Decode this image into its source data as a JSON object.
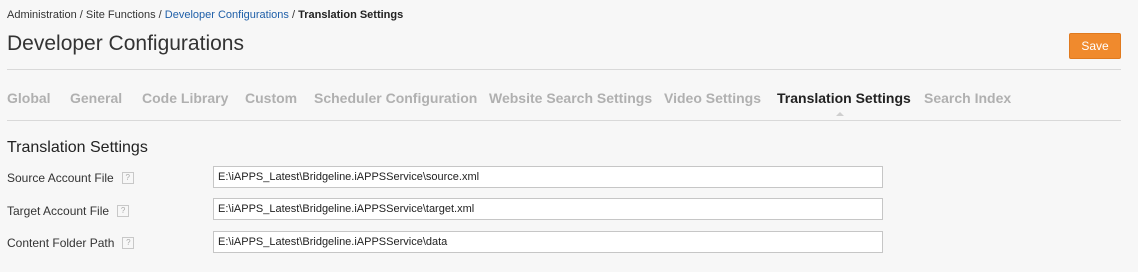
{
  "breadcrumb": {
    "items": [
      "Administration",
      "Site Functions",
      "Developer Configurations",
      "Translation Settings"
    ],
    "separator": "/"
  },
  "page": {
    "title": "Developer Configurations",
    "save_label": "Save"
  },
  "tabs": [
    {
      "label": "Global"
    },
    {
      "label": "General"
    },
    {
      "label": "Code Library"
    },
    {
      "label": "Custom"
    },
    {
      "label": "Scheduler Configuration"
    },
    {
      "label": "Website Search Settings"
    },
    {
      "label": "Video Settings"
    },
    {
      "label": "Translation Settings",
      "active": true
    },
    {
      "label": "Search Index"
    }
  ],
  "section": {
    "title": "Translation Settings",
    "fields": [
      {
        "label": "Source Account File",
        "value": "E:\\iAPPS_Latest\\Bridgeline.iAPPSService\\source.xml"
      },
      {
        "label": "Target Account File",
        "value": "E:\\iAPPS_Latest\\Bridgeline.iAPPSService\\target.xml"
      },
      {
        "label": "Content Folder Path",
        "value": "E:\\iAPPS_Latest\\Bridgeline.iAPPSService\\data"
      }
    ],
    "help_glyph": "?"
  },
  "colors": {
    "accent": "#f08a2d",
    "link": "#1f5fa8",
    "tab_inactive": "#b0b0b0",
    "tab_active": "#222222"
  },
  "icons": {
    "help": "help-icon",
    "active_tab_indicator": "caret-up-icon"
  }
}
